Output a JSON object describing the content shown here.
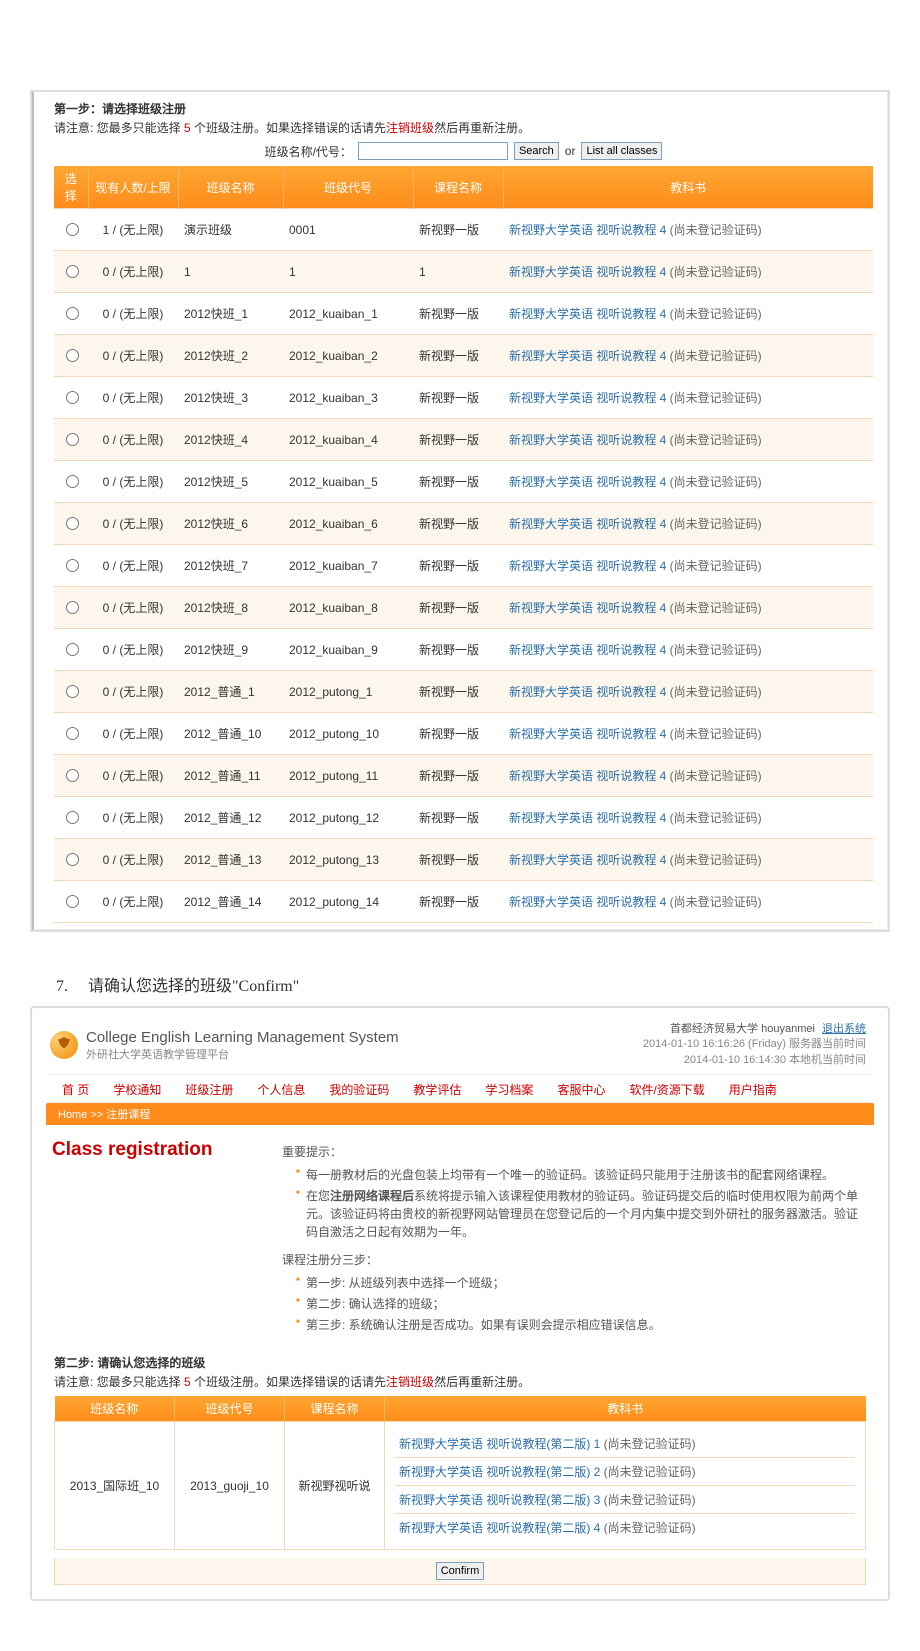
{
  "step1": {
    "title": "第一步：请选择班级注册",
    "note_prefix": "请注意: 您最多只能选择 ",
    "note_count": "5",
    "note_suffix": " 个班级注册。如果选择错误的话请先",
    "unreg_link": "注销班级",
    "note_end": "然后再重新注册。",
    "search_label": "班级名称/代号：",
    "search_btn": "Search",
    "or_label": "or",
    "list_btn": "List all classes",
    "headers": {
      "select": "选择",
      "count": "现有人数/上限",
      "name": "班级名称",
      "code": "班级代号",
      "course": "课程名称",
      "book": "教科书"
    },
    "book_link_text": "新视野大学英语 视听说教程 4",
    "book_note": " (尚未登记验证码)",
    "rows": [
      {
        "count": "1 / (无上限)",
        "name": "演示班级",
        "code": "0001",
        "course": "新视野一版"
      },
      {
        "count": "0 / (无上限)",
        "name": "1",
        "code": "1",
        "course": "1"
      },
      {
        "count": "0 / (无上限)",
        "name": "2012快班_1",
        "code": "2012_kuaiban_1",
        "course": "新视野一版"
      },
      {
        "count": "0 / (无上限)",
        "name": "2012快班_2",
        "code": "2012_kuaiban_2",
        "course": "新视野一版"
      },
      {
        "count": "0 / (无上限)",
        "name": "2012快班_3",
        "code": "2012_kuaiban_3",
        "course": "新视野一版"
      },
      {
        "count": "0 / (无上限)",
        "name": "2012快班_4",
        "code": "2012_kuaiban_4",
        "course": "新视野一版"
      },
      {
        "count": "0 / (无上限)",
        "name": "2012快班_5",
        "code": "2012_kuaiban_5",
        "course": "新视野一版"
      },
      {
        "count": "0 / (无上限)",
        "name": "2012快班_6",
        "code": "2012_kuaiban_6",
        "course": "新视野一版"
      },
      {
        "count": "0 / (无上限)",
        "name": "2012快班_7",
        "code": "2012_kuaiban_7",
        "course": "新视野一版"
      },
      {
        "count": "0 / (无上限)",
        "name": "2012快班_8",
        "code": "2012_kuaiban_8",
        "course": "新视野一版"
      },
      {
        "count": "0 / (无上限)",
        "name": "2012快班_9",
        "code": "2012_kuaiban_9",
        "course": "新视野一版"
      },
      {
        "count": "0 / (无上限)",
        "name": "2012_普通_1",
        "code": "2012_putong_1",
        "course": "新视野一版"
      },
      {
        "count": "0 / (无上限)",
        "name": "2012_普通_10",
        "code": "2012_putong_10",
        "course": "新视野一版"
      },
      {
        "count": "0 / (无上限)",
        "name": "2012_普通_11",
        "code": "2012_putong_11",
        "course": "新视野一版"
      },
      {
        "count": "0 / (无上限)",
        "name": "2012_普通_12",
        "code": "2012_putong_12",
        "course": "新视野一版"
      },
      {
        "count": "0 / (无上限)",
        "name": "2012_普通_13",
        "code": "2012_putong_13",
        "course": "新视野一版"
      },
      {
        "count": "0 / (无上限)",
        "name": "2012_普通_14",
        "code": "2012_putong_14",
        "course": "新视野一版"
      }
    ]
  },
  "doc_step7": {
    "num": "7.",
    "text": "请确认您选择的班级\"Confirm\""
  },
  "header": {
    "title_en": "College English Learning Management System",
    "title_cn": "外研社大学英语教学管理平台",
    "university": "首都经济贸易大学",
    "username": "houyanmei",
    "logout": "退出系统",
    "time1": "2014-01-10 16:16:26 (Friday) 服务器当前时间",
    "time2": "2014-01-10 16:14:30 本地机当前时间"
  },
  "nav": [
    "首 页",
    "学校通知",
    "班级注册",
    "个人信息",
    "我的验证码",
    "教学评估",
    "学习档案",
    "客服中心",
    "软件/资源下载",
    "用户指南"
  ],
  "crumb": "Home >> 注册课程",
  "cr": {
    "title": "Class registration",
    "important_title": "重要提示：",
    "tip1": "每一册教材后的光盘包装上均带有一个唯一的验证码。该验证码只能用于注册该书的配套网络课程。",
    "tip2_prefix": "在您",
    "tip2_bold": "注册网络课程后",
    "tip2_suffix": "系统将提示输入该课程使用教材的验证码。验证码提交后的临时使用权限为前两个单元。该验证码将由贵校的新视野网站管理员在您登记后的一个月内集中提交到外研社的服务器激活。验证码自激活之日起有效期为一年。",
    "steps_title": "课程注册分三步：",
    "step_a": "第一步: 从班级列表中选择一个班级；",
    "step_b": "第二步: 确认选择的班级；",
    "step_c": "第三步: 系统确认注册是否成功。如果有误则会提示相应错误信息。"
  },
  "step2": {
    "title": "第二步: 请确认您选择的班级",
    "note_prefix": "请注意: 您最多只能选择 ",
    "note_count": "5",
    "note_suffix": " 个班级注册。如果选择错误的话请先",
    "unreg_link": "注销班级",
    "note_end": "然后再重新注册。",
    "headers": {
      "name": "班级名称",
      "code": "班级代号",
      "course": "课程名称",
      "book": "教科书"
    },
    "row": {
      "name": "2013_国际班_10",
      "code": "2013_guoji_10",
      "course": "新视野视听说"
    },
    "books_prefix": "新视野大学英语 视听说教程(第二版) ",
    "books": [
      "1",
      "2",
      "3",
      "4"
    ],
    "book_note": " (尚未登记验证码)",
    "confirm_btn": "Confirm"
  }
}
